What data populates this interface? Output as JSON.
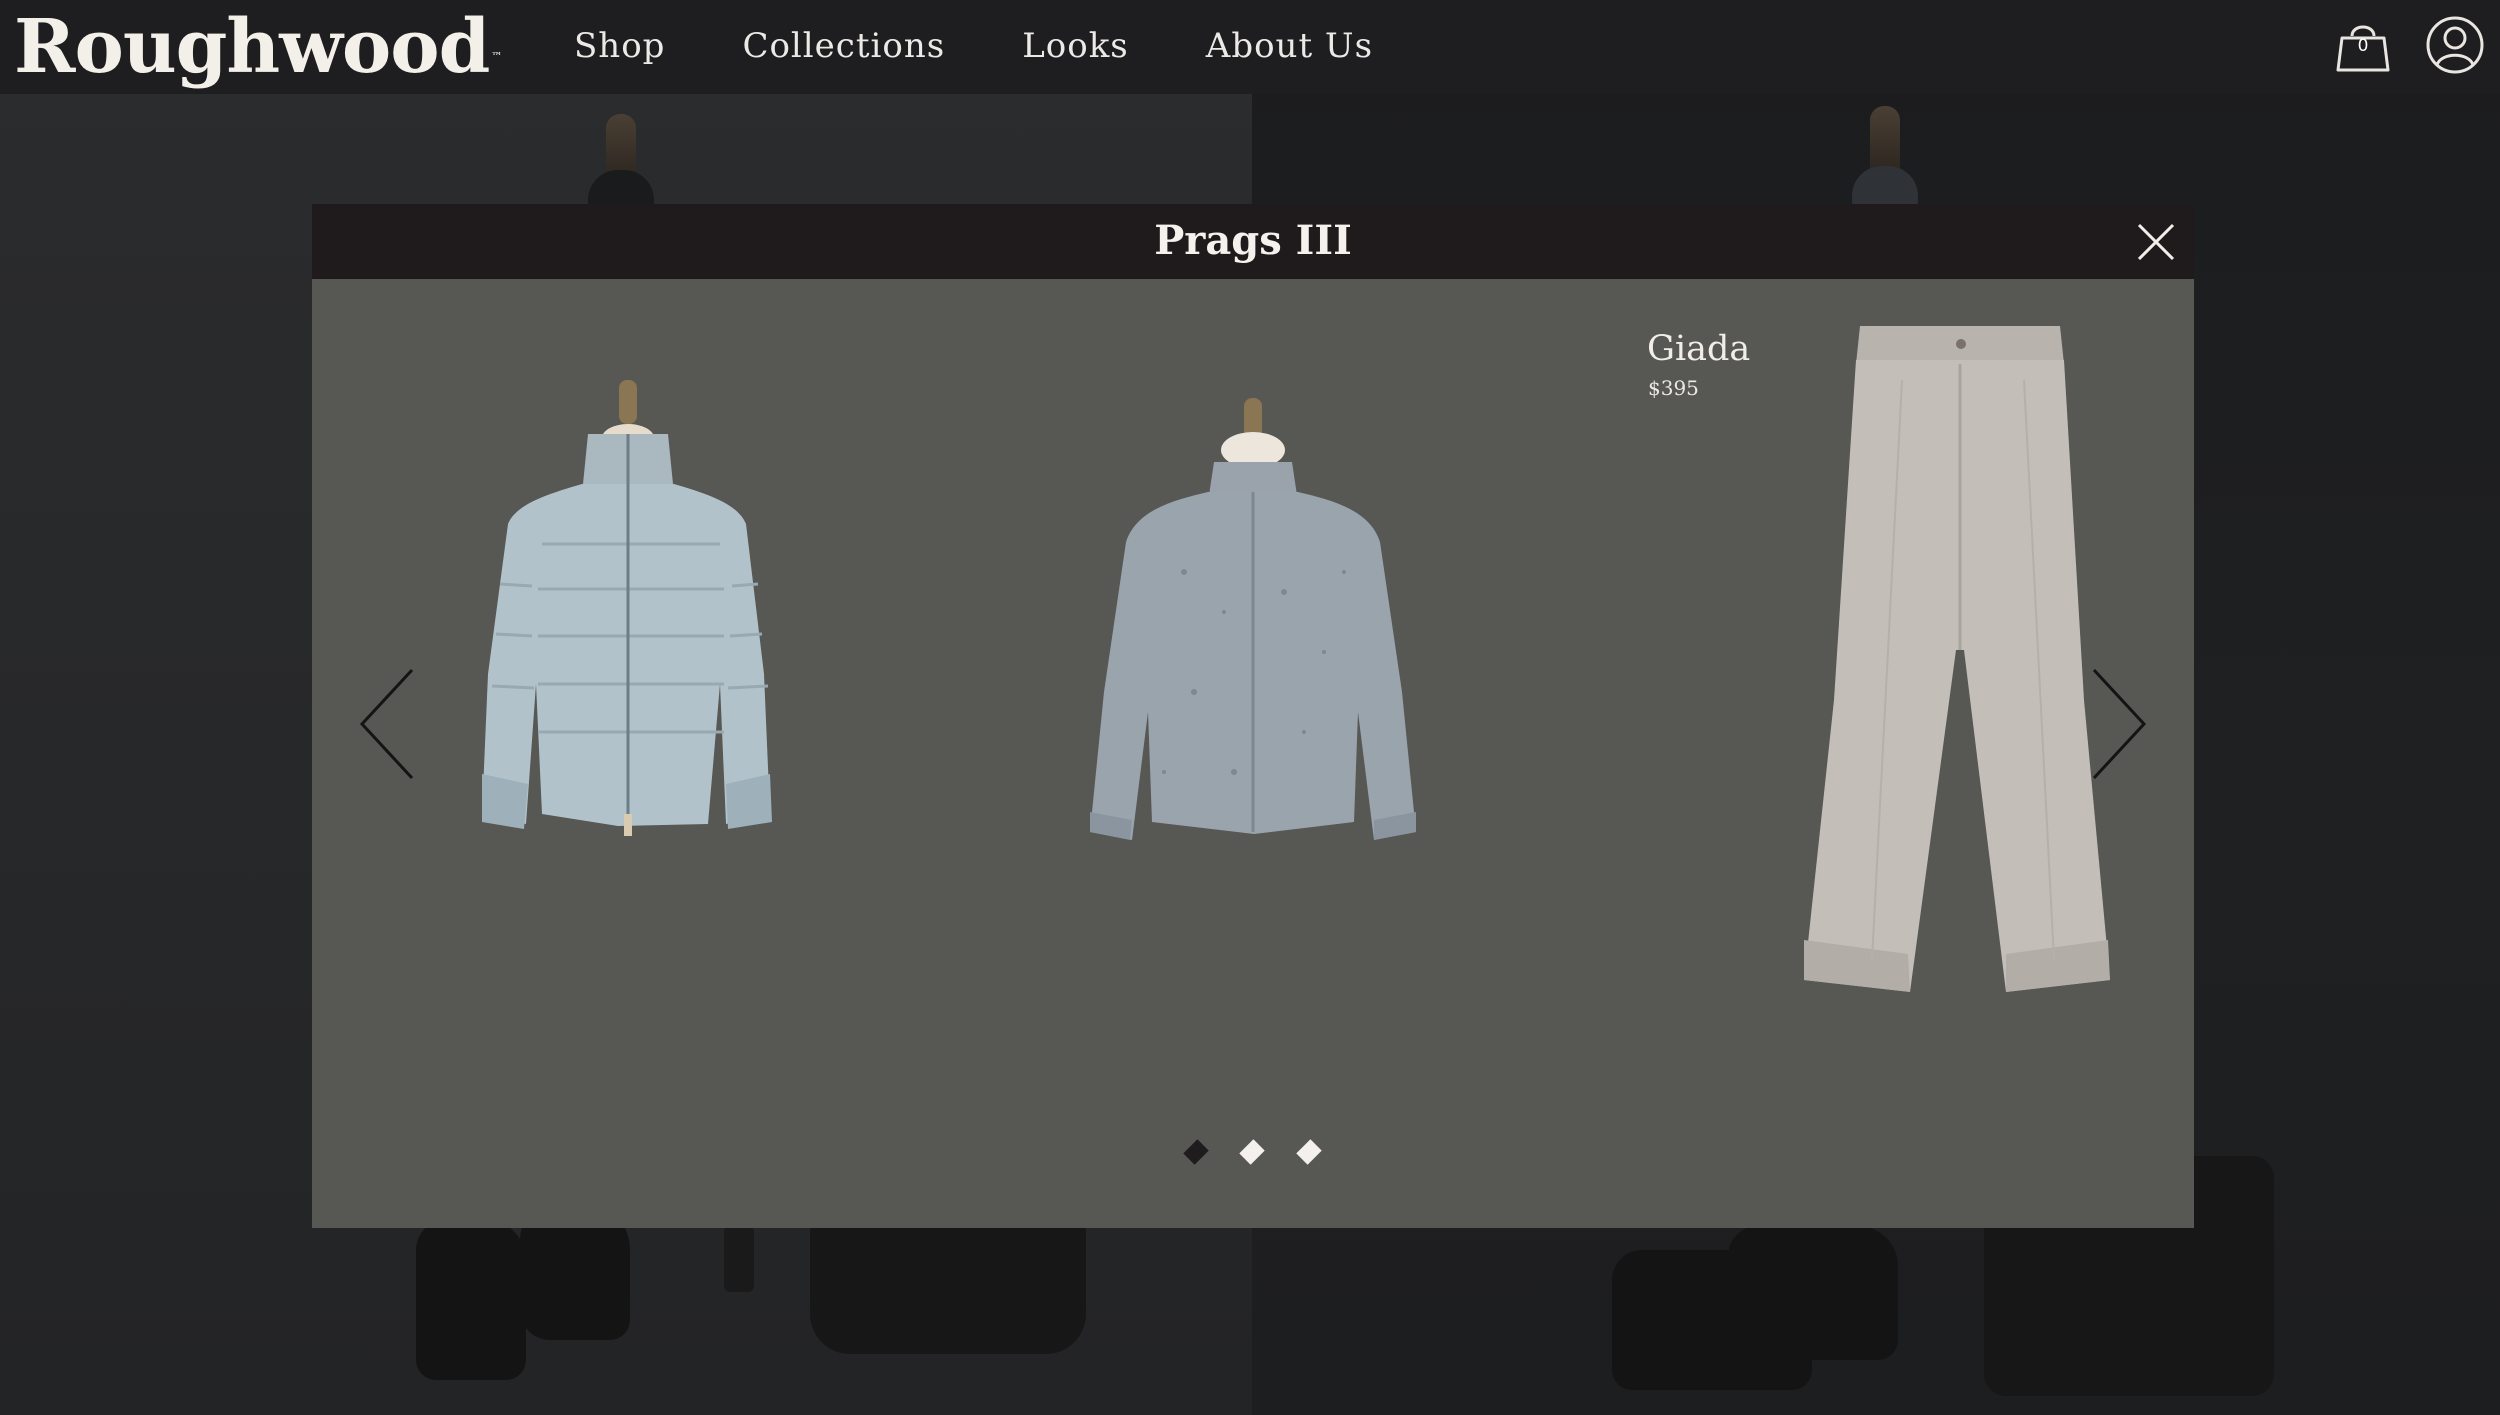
{
  "brand": {
    "name": "Roughwood",
    "trademark": "™"
  },
  "nav": {
    "items": [
      {
        "label": "Shop"
      },
      {
        "label": "Collections"
      },
      {
        "label": "Looks"
      },
      {
        "label": "About Us"
      }
    ]
  },
  "header": {
    "cart_icon": "shopping-bag-icon",
    "cart_count": "0",
    "account_icon": "user-circle-icon"
  },
  "modal": {
    "title": "Prags III",
    "close_icon": "close-icon",
    "prev_icon": "chevron-left-icon",
    "next_icon": "chevron-right-icon",
    "products": [
      {
        "image": "light blue quilted puffer jacket on mannequin",
        "name": "",
        "price": ""
      },
      {
        "image": "grey knit cardigan on mannequin",
        "name": "",
        "price": ""
      },
      {
        "image": "light taupe wide-leg trousers",
        "name": "Giada",
        "price": "$395"
      }
    ],
    "hovered_product": {
      "name": "Giada",
      "price": "$395"
    },
    "pagination": {
      "pages": 3,
      "current": 1
    }
  },
  "colors": {
    "header_bg": "#1e1d1f",
    "modal_bg": "#575754",
    "modal_header_bg": "#1f1b1c",
    "text": "#f2efea"
  }
}
